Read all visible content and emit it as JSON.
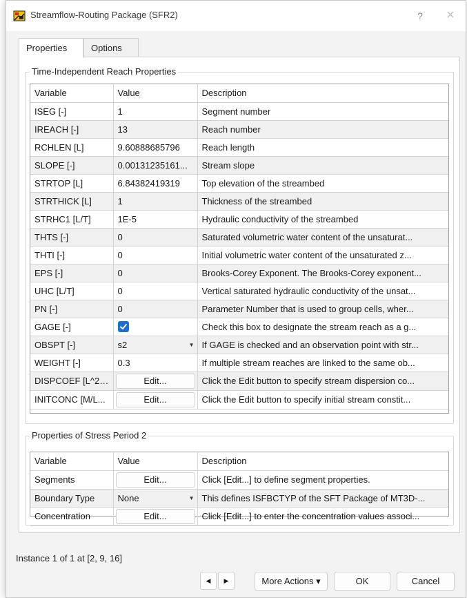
{
  "window": {
    "title": "Streamflow-Routing Package (SFR2)",
    "help_glyph": "?",
    "close_glyph": "✕"
  },
  "tabs": [
    "Properties",
    "Options"
  ],
  "group1": {
    "title": "Time-Independent Reach Properties",
    "headers": [
      "Variable",
      "Value",
      "Description"
    ],
    "rows": [
      {
        "variable": "ISEG [-]",
        "value": "1",
        "description": "Segment number"
      },
      {
        "variable": "IREACH [-]",
        "value": "13",
        "description": "Reach number"
      },
      {
        "variable": "RCHLEN [L]",
        "value": "9.60888685796",
        "description": "Reach length"
      },
      {
        "variable": "SLOPE [-]",
        "value": "0.00131235161...",
        "description": "Stream slope"
      },
      {
        "variable": "STRTOP [L]",
        "value": "6.84382419319",
        "description": "Top elevation of the streambed"
      },
      {
        "variable": "STRTHICK [L]",
        "value": "1",
        "description": "Thickness of the streambed"
      },
      {
        "variable": "STRHC1 [L/T]",
        "value": "1E-5",
        "description": "Hydraulic conductivity of the streambed"
      },
      {
        "variable": "THTS [-]",
        "value": "0",
        "description": "Saturated volumetric water content of the unsaturat..."
      },
      {
        "variable": "THTI [-]",
        "value": "0",
        "description": "Initial volumetric water content of the unsaturated z..."
      },
      {
        "variable": "EPS [-]",
        "value": "0",
        "description": "Brooks-Corey Exponent. The Brooks-Corey exponent..."
      },
      {
        "variable": "UHC [L/T]",
        "value": "0",
        "description": "Vertical saturated hydraulic conductivity of the unsat..."
      },
      {
        "variable": "PN [-]",
        "value": "0",
        "description": "Parameter Number that is used to group cells, wher..."
      },
      {
        "variable": "GAGE [-]",
        "value": "",
        "description": "Check this box to designate the stream reach as a g..."
      },
      {
        "variable": "OBSPT [-]",
        "value": "s2",
        "description": "If GAGE is checked and an observation point with str..."
      },
      {
        "variable": "WEIGHT [-]",
        "value": "0.3",
        "description": "If multiple stream reaches are linked to the same ob..."
      },
      {
        "variable": "DISPCOEF [L^2/...",
        "value": "Edit...",
        "description": "Click the Edit button to specify stream dispersion co..."
      },
      {
        "variable": "INITCONC [M/L...",
        "value": "Edit...",
        "description": "Click the Edit button to specify initial stream constit..."
      }
    ]
  },
  "group2": {
    "title": "Properties of Stress Period 2",
    "headers": [
      "Variable",
      "Value",
      "Description"
    ],
    "rows": [
      {
        "variable": "Segments",
        "value": "Edit...",
        "description": "Click [Edit...] to define segment properties."
      },
      {
        "variable": "Boundary Type",
        "value": "None",
        "description": "This defines ISFBCTYP of the SFT Package of MT3D-..."
      },
      {
        "variable": "Concentration",
        "value": "Edit...",
        "description": "Click [Edit...] to enter the concentration values associ..."
      }
    ]
  },
  "status": "Instance 1 of 1 at [2, 9, 16]",
  "buttons": {
    "prev": "◀",
    "next": "▶",
    "more_actions": "More Actions ▾",
    "ok": "OK",
    "cancel": "Cancel"
  },
  "colors": {
    "accent": "#1a6ed8",
    "row_alt": "#f0f0f0",
    "dialog_bg": "#f3f3f3"
  },
  "gage_checked": true
}
